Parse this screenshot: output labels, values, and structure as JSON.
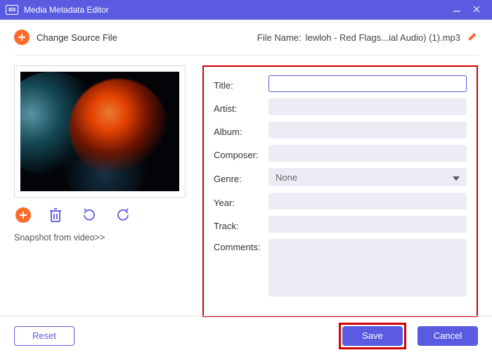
{
  "titlebar": {
    "app_icon_text": "ID3",
    "title": "Media Metadata Editor"
  },
  "toprow": {
    "change_source": "Change Source File",
    "file_name_label": "File Name:",
    "file_name_value": "lewloh - Red Flags...ial Audio) (1).mp3"
  },
  "left": {
    "snapshot_link": "Snapshot from video>>"
  },
  "fields": {
    "title_label": "Title:",
    "title_value": "",
    "artist_label": "Artist:",
    "artist_value": "",
    "album_label": "Album:",
    "album_value": "",
    "composer_label": "Composer:",
    "composer_value": "",
    "genre_label": "Genre:",
    "genre_value": "None",
    "year_label": "Year:",
    "year_value": "",
    "track_label": "Track:",
    "track_value": "",
    "comments_label": "Comments:",
    "comments_value": ""
  },
  "footer": {
    "reset": "Reset",
    "save": "Save",
    "cancel": "Cancel"
  }
}
